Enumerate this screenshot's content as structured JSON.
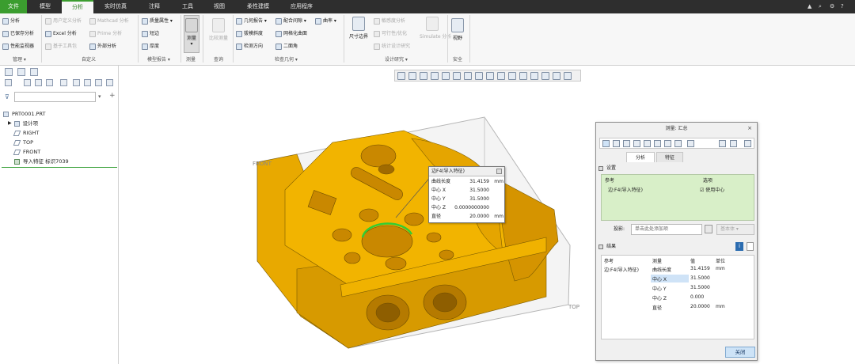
{
  "menu": {
    "tabs": [
      "文件",
      "模型",
      "分析",
      "实时仿真",
      "注释",
      "工具",
      "视图",
      "柔性建模",
      "应用程序"
    ],
    "active": "分析"
  },
  "ribbon": {
    "manage": {
      "items": [
        "分析",
        "已保存分析",
        "性能监视器"
      ],
      "label": "管理"
    },
    "custom": {
      "items": [
        "用户定义分析",
        "Excel 分析",
        "基于工具包",
        "Mathcad 分析",
        "Prime 分析",
        "外部分析"
      ],
      "label": "自定义"
    },
    "model_report": {
      "items": [
        "质量属性",
        "短边",
        "厚度"
      ],
      "label": "模型报告"
    },
    "measure": {
      "button": "测量",
      "label": "测量"
    },
    "query": {
      "button": "比较测量",
      "label": "查询"
    },
    "check_geometry": {
      "items": [
        "几何报告",
        "拔模斜度",
        "检测方向",
        "配合间隙",
        "网格化曲面",
        "二面角",
        "曲率"
      ],
      "label": "检查几何"
    },
    "design_study": {
      "items": [
        "尺寸边界",
        "敏感度分析",
        "可行性/优化",
        "统计设计研究",
        "Simulate 分析"
      ],
      "label": "设计研究"
    },
    "safety": {
      "button": "视野",
      "label": "安全"
    }
  },
  "left_panel": {
    "filter_placeholder": "",
    "tree": [
      "PRT0001.PRT",
      "设计项",
      "RIGHT",
      "TOP",
      "FRONT",
      "导入特征 标识7039"
    ]
  },
  "viewport_labels": {
    "front": "FRONT",
    "top": "TOP"
  },
  "tooltip": {
    "title": "边F4(导入特征)",
    "rows": [
      {
        "key": "曲线长度",
        "value": "31.4159",
        "unit": "mm"
      },
      {
        "key": "中心 X",
        "value": "31.5000",
        "unit": ""
      },
      {
        "key": "中心 Y",
        "value": "31.5000",
        "unit": ""
      },
      {
        "key": "中心 Z",
        "value": "0.0000000000",
        "unit": ""
      },
      {
        "key": "直径",
        "value": "20.0000",
        "unit": "mm"
      }
    ]
  },
  "dialog": {
    "title": "测量: 汇总",
    "close_x": "×",
    "tabs": [
      "分析",
      "特征"
    ],
    "settings_header": "设置",
    "ref_header": "参考",
    "option_header": "选项",
    "ref_value": "边:F4(导入特征)",
    "option_value": "☑ 使用中心",
    "projection_label": "投影:",
    "projection_placeholder": "单击此处添加项",
    "projection_option": "基本体",
    "results_header": "结果",
    "results_cols": [
      "参考",
      "测量",
      "值",
      "单位"
    ],
    "results_rows": [
      {
        "ref": "边:F4(导入特征)",
        "measure": "曲线长度",
        "value": "31.4159",
        "unit": "mm"
      },
      {
        "ref": "",
        "measure": "中心 X",
        "value": "31.5000",
        "unit": ""
      },
      {
        "ref": "",
        "measure": "中心 Y",
        "value": "31.5000",
        "unit": ""
      },
      {
        "ref": "",
        "measure": "中心 Z",
        "value": "0.000",
        "unit": ""
      },
      {
        "ref": "",
        "measure": "直径",
        "value": "20.0000",
        "unit": "mm"
      }
    ],
    "close_button": "关闭"
  },
  "colors": {
    "accent": "#3b9d2f",
    "part": "#f2b000",
    "part_dark": "#c88a00",
    "measure_edge": "#33cc33"
  }
}
